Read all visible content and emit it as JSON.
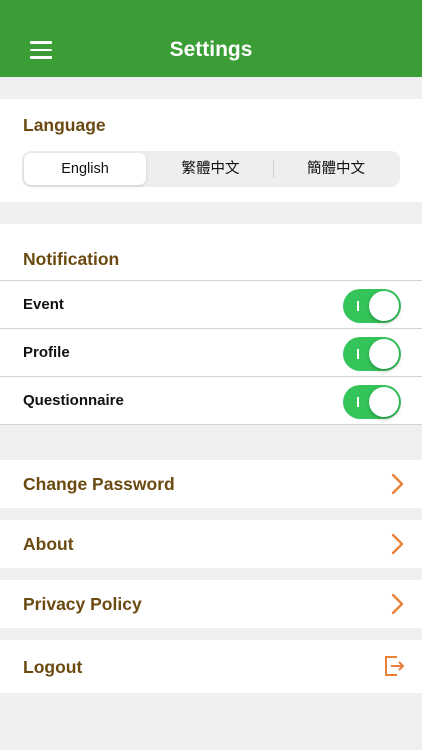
{
  "header": {
    "title": "Settings"
  },
  "language": {
    "title": "Language",
    "options": [
      "English",
      "繁體中文",
      "簡體中文"
    ],
    "selected_index": 0
  },
  "notification": {
    "title": "Notification",
    "items": [
      {
        "label": "Event",
        "enabled": true
      },
      {
        "label": "Profile",
        "enabled": true
      },
      {
        "label": "Questionnaire",
        "enabled": true
      }
    ]
  },
  "links": {
    "change_password": "Change Password",
    "about": "About",
    "privacy_policy": "Privacy Policy",
    "logout": "Logout"
  },
  "colors": {
    "header": "#3a9d35",
    "accent_text": "#6b4a12",
    "toggle_on": "#34c45a",
    "chevron": "#e8823a"
  },
  "icons": {
    "menu": "hamburger-icon",
    "chevron": "chevron-right-icon",
    "logout": "logout-icon"
  }
}
